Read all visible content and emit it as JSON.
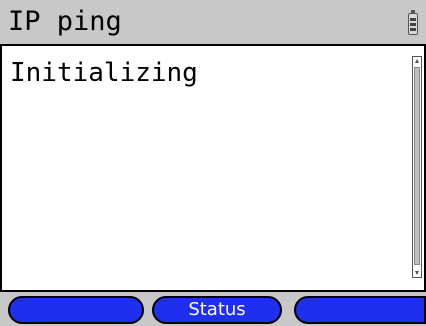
{
  "header": {
    "title": "IP ping",
    "battery_icon": "battery-icon"
  },
  "main": {
    "status_text": "Initializing"
  },
  "softkeys": {
    "left_label": "",
    "middle_label": "Status",
    "right_label": ""
  },
  "colors": {
    "softkey_blue": "#1e2ff0",
    "bar_gray": "#c8c8c8",
    "background": "#ffffff"
  }
}
